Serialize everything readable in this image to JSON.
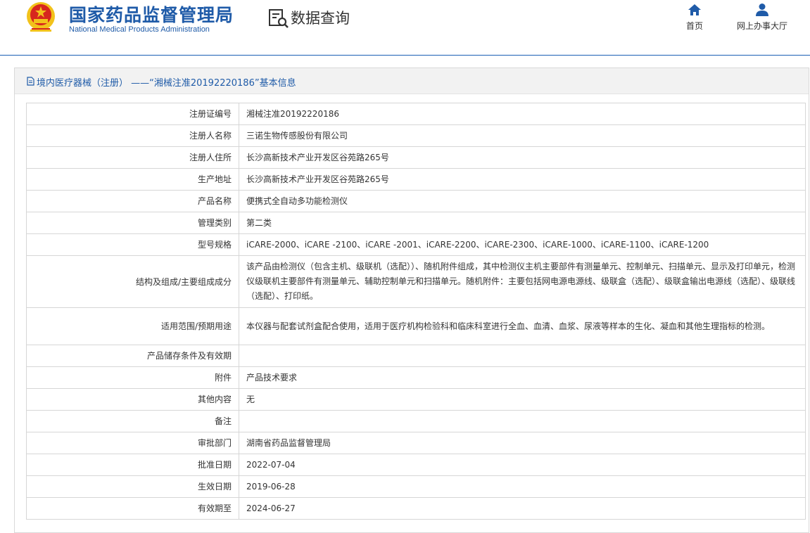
{
  "header": {
    "title_cn": "国家药品监督管理局",
    "title_en": "National Medical Products Administration",
    "query_label": "数据查询",
    "nav": [
      {
        "label": "首页",
        "icon": "home-icon"
      },
      {
        "label": "网上办事大厅",
        "icon": "user-icon"
      }
    ]
  },
  "colors": {
    "brand": "#1f5ba8",
    "emblem_red": "#d7261e",
    "emblem_gold": "#f2c21b"
  },
  "panel": {
    "title": "境内医疗器械（注册） ——“湘械注准20192220186”基本信息"
  },
  "rows": [
    {
      "label": "注册证编号",
      "value": "湘械注准20192220186"
    },
    {
      "label": "注册人名称",
      "value": "三诺生物传感股份有限公司"
    },
    {
      "label": "注册人住所",
      "value": "长沙高新技术产业开发区谷苑路265号"
    },
    {
      "label": "生产地址",
      "value": "长沙高新技术产业开发区谷苑路265号"
    },
    {
      "label": "产品名称",
      "value": "便携式全自动多功能检测仪"
    },
    {
      "label": "管理类别",
      "value": "第二类"
    },
    {
      "label": "型号规格",
      "value": "iCARE-2000、iCARE -2100、iCARE -2001、iCARE-2200、iCARE-2300、iCARE-1000、iCARE-1100、iCARE-1200"
    },
    {
      "label": "结构及组成/主要组成成分",
      "value": "该产品由检测仪（包含主机、级联机（选配））、随机附件组成，其中检测仪主机主要部件有测量单元、控制单元、扫描单元、显示及打印单元，检测仪级联机主要部件有测量单元、辅助控制单元和扫描单元。随机附件：主要包括网电源电源线、级联盒（选配）、级联盒输出电源线（选配）、级联线（选配）、打印纸。"
    },
    {
      "label": "适用范围/预期用途",
      "value": "本仪器与配套试剂盒配合使用，适用于医疗机构检验科和临床科室进行全血、血清、血浆、尿液等样本的生化、凝血和其他生理指标的检测。"
    },
    {
      "label": "产品储存条件及有效期",
      "value": ""
    },
    {
      "label": "附件",
      "value": "产品技术要求"
    },
    {
      "label": "其他内容",
      "value": "无"
    },
    {
      "label": "备注",
      "value": ""
    },
    {
      "label": "审批部门",
      "value": "湖南省药品监督管理局"
    },
    {
      "label": "批准日期",
      "value": "2022-07-04"
    },
    {
      "label": "生效日期",
      "value": "2019-06-28"
    },
    {
      "label": "有效期至",
      "value": "2024-06-27"
    }
  ]
}
